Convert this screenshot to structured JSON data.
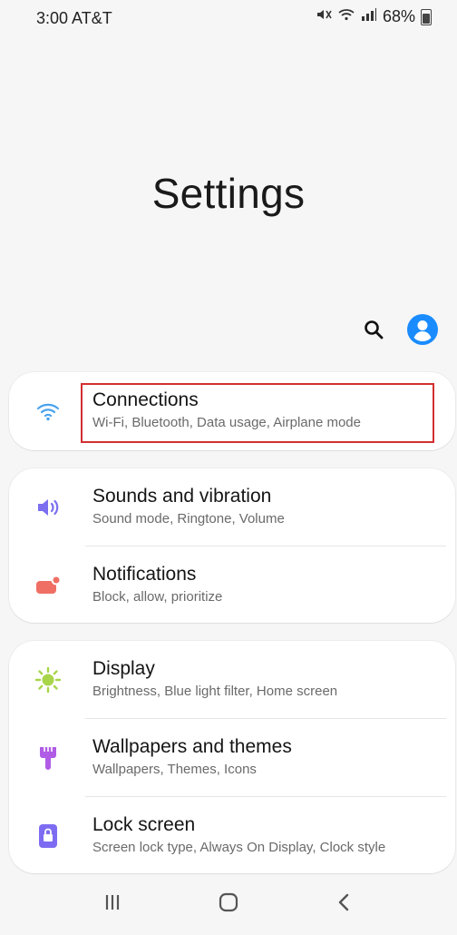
{
  "status_bar": {
    "time_carrier": "3:00 AT&T",
    "battery": "68%",
    "battery_level": 0.68
  },
  "header": {
    "title": "Settings"
  },
  "menu": {
    "connections": {
      "title": "Connections",
      "subtitle": "Wi-Fi, Bluetooth, Data usage, Airplane mode",
      "icon": "wifi-icon",
      "icon_color": "#4aa3ef"
    },
    "sounds": {
      "title": "Sounds and vibration",
      "subtitle": "Sound mode, Ringtone, Volume",
      "icon": "speaker-icon",
      "icon_color": "#7b6ff0"
    },
    "notifications": {
      "title": "Notifications",
      "subtitle": "Block, allow, prioritize",
      "icon": "notification-icon",
      "icon_color": "#ef6f64"
    },
    "display": {
      "title": "Display",
      "subtitle": "Brightness, Blue light filter, Home screen",
      "icon": "sun-icon",
      "icon_color": "#a8d54a"
    },
    "wallpapers": {
      "title": "Wallpapers and themes",
      "subtitle": "Wallpapers, Themes, Icons",
      "icon": "brush-icon",
      "icon_color": "#b05ce6"
    },
    "lockscreen": {
      "title": "Lock screen",
      "subtitle": "Screen lock type, Always On Display, Clock style",
      "icon": "lock-icon",
      "icon_color": "#7d6cf2"
    }
  },
  "colors": {
    "accent": "#1a8cff",
    "highlight": "#d32f2f"
  }
}
